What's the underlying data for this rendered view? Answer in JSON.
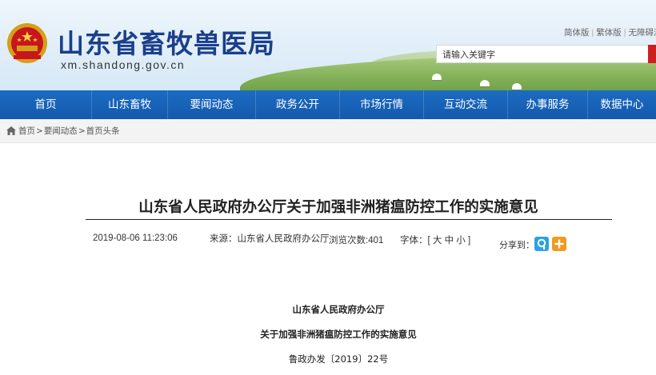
{
  "header": {
    "site_title": "山东省畜牧兽医局",
    "site_domain": "xm.shandong.gov.cn",
    "top_links": [
      "简体版",
      "繁体版",
      "无障碍浏"
    ],
    "search_placeholder": "请输入关键字"
  },
  "nav": {
    "items": [
      "首页",
      "山东畜牧",
      "要闻动态",
      "政务公开",
      "市场行情",
      "互动交流",
      "办事服务",
      "数据中心"
    ]
  },
  "breadcrumb": [
    "首页",
    "要闻动态",
    "首页头条"
  ],
  "article": {
    "title": "山东省人民政府办公厅关于加强非洲猪瘟防控工作的实施意见",
    "datetime": "2019-08-06 11:23:06",
    "source": "来源：山东省人民政府办公厅",
    "views": "浏览次数:401",
    "font_size_label": "字体：[ 大 中 小 ]",
    "share_label": "分享到：",
    "body_issuer": "山东省人民政府办公厅",
    "body_title": "关于加强非洲猪瘟防控工作的实施意见",
    "body_doc_number": "鲁政办发〔2019〕22号"
  },
  "colors": {
    "nav_blue": "#1766bb",
    "title_blue": "#1b3f8c",
    "search_red": "#cc1f1f",
    "share_blue": "#2aa3e0",
    "share_orange": "#f19a1f"
  }
}
